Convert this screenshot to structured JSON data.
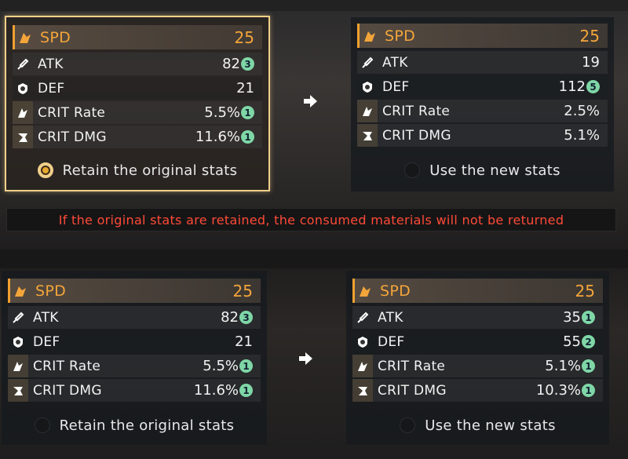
{
  "warning_text": "If the original stats are retained, the consumed materials will not be returned",
  "accent_color": "#f4a53a",
  "badge_color": "#7fd6a6",
  "top": {
    "original": {
      "main": {
        "label": "SPD",
        "value": "25",
        "icon": "speed-icon"
      },
      "stats": [
        {
          "label": "ATK",
          "value": "82",
          "badge": "3",
          "icon": "atk-icon"
        },
        {
          "label": "DEF",
          "value": "21",
          "badge": "",
          "icon": "def-icon"
        },
        {
          "label": "CRIT Rate",
          "value": "5.5%",
          "badge": "1",
          "icon": "crit-rate-icon"
        },
        {
          "label": "CRIT DMG",
          "value": "11.6%",
          "badge": "1",
          "icon": "crit-dmg-icon"
        }
      ],
      "choice": "Retain the original stats",
      "selected": true
    },
    "new": {
      "main": {
        "label": "SPD",
        "value": "25",
        "icon": "speed-icon"
      },
      "stats": [
        {
          "label": "ATK",
          "value": "19",
          "badge": "",
          "icon": "atk-icon"
        },
        {
          "label": "DEF",
          "value": "112",
          "badge": "5",
          "icon": "def-icon"
        },
        {
          "label": "CRIT Rate",
          "value": "2.5%",
          "badge": "",
          "icon": "crit-rate-icon"
        },
        {
          "label": "CRIT DMG",
          "value": "5.1%",
          "badge": "",
          "icon": "crit-dmg-icon"
        }
      ],
      "choice": "Use the new stats",
      "selected": false
    }
  },
  "bottom": {
    "original": {
      "main": {
        "label": "SPD",
        "value": "25",
        "icon": "speed-icon"
      },
      "stats": [
        {
          "label": "ATK",
          "value": "82",
          "badge": "3",
          "icon": "atk-icon"
        },
        {
          "label": "DEF",
          "value": "21",
          "badge": "",
          "icon": "def-icon"
        },
        {
          "label": "CRIT Rate",
          "value": "5.5%",
          "badge": "1",
          "icon": "crit-rate-icon"
        },
        {
          "label": "CRIT DMG",
          "value": "11.6%",
          "badge": "1",
          "icon": "crit-dmg-icon"
        }
      ],
      "choice": "Retain the original stats",
      "selected": false
    },
    "new": {
      "main": {
        "label": "SPD",
        "value": "25",
        "icon": "speed-icon"
      },
      "stats": [
        {
          "label": "ATK",
          "value": "35",
          "badge": "1",
          "icon": "atk-icon"
        },
        {
          "label": "DEF",
          "value": "55",
          "badge": "2",
          "icon": "def-icon"
        },
        {
          "label": "CRIT Rate",
          "value": "5.1%",
          "badge": "1",
          "icon": "crit-rate-icon"
        },
        {
          "label": "CRIT DMG",
          "value": "10.3%",
          "badge": "1",
          "icon": "crit-dmg-icon"
        }
      ],
      "choice": "Use the new stats",
      "selected": false
    }
  }
}
